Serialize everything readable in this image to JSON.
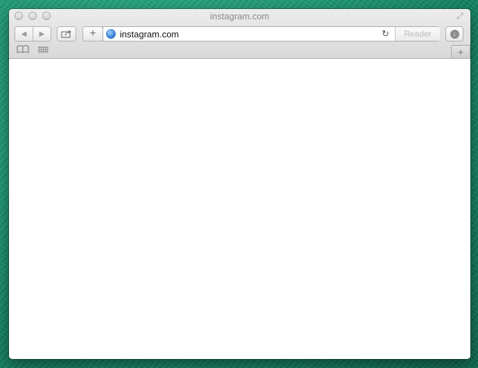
{
  "window": {
    "title": "instagram.com"
  },
  "toolbar": {
    "back_glyph": "◀",
    "forward_glyph": "▶",
    "add_glyph": "+",
    "reload_glyph": "↻",
    "reader_label": "Reader",
    "download_glyph": "↓",
    "fullscreen_glyph": "⤢",
    "newtab_glyph": "+",
    "bookmarks_glyph": "📖"
  },
  "address": {
    "url": "instagram.com"
  }
}
